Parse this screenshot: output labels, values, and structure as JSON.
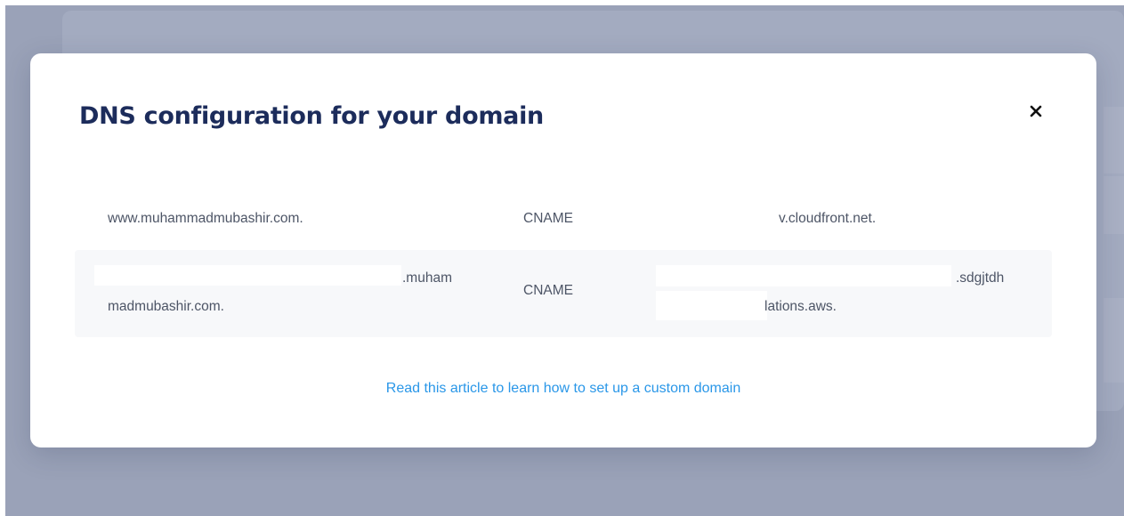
{
  "modal": {
    "title": "DNS configuration for your domain",
    "close_icon": "close-icon"
  },
  "dns_records": [
    {
      "host": "www.muhammadmubashir.com.",
      "type": "CNAME",
      "value": "v.cloudfront.net."
    },
    {
      "host_part_1": ".muham",
      "host_part_2": "madmubashir.com.",
      "type": "CNAME",
      "value_part_1": ".sdgjtdh",
      "value_part_2": "lations.aws."
    }
  ],
  "article_link": {
    "label": "Read this article to learn how to set up a custom domain"
  },
  "colors": {
    "overlay": "#9aa2b8",
    "title": "#1c2c5b",
    "text": "#4d5566",
    "link": "#2a97e8",
    "row_highlight": "#f7f8fa"
  }
}
